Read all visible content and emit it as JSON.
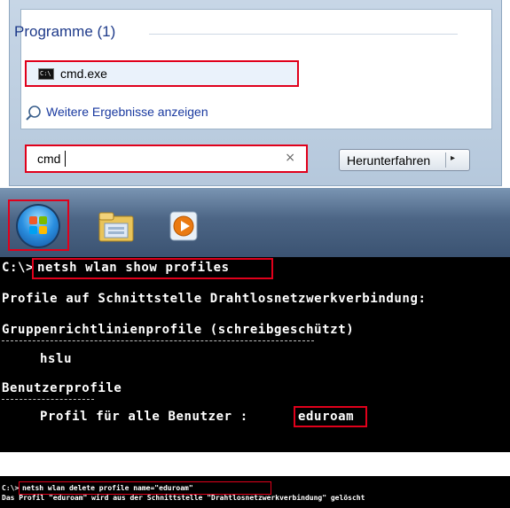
{
  "start_menu": {
    "section_header": "Programme (1)",
    "result_item": {
      "label": "cmd.exe",
      "icon": "cmd-icon"
    },
    "more_results_link": "Weitere Ergebnisse anzeigen",
    "search": {
      "value": "cmd"
    },
    "clear_symbol": "×",
    "shutdown_button": {
      "label": "Herunterfahren",
      "arrow": "▸"
    }
  },
  "taskbar": {
    "items": [
      "start-orb-icon",
      "windows-explorer-icon",
      "windows-media-player-icon"
    ]
  },
  "console_1": {
    "prompt": "C:\\>",
    "command": "netsh wlan show profiles",
    "line_interface": "Profile auf Schnittstelle Drahtlosnetzwerkverbindung:",
    "group_policy_header": "Gruppenrichtlinienprofile (schreibgeschützt)",
    "group_policy_profile": "hslu",
    "user_profiles_header": "Benutzerprofile",
    "user_profile_label": "Profil für alle Benutzer : ",
    "user_profile_value": "eduroam"
  },
  "console_2": {
    "prompt": "C:\\>",
    "command": "netsh wlan delete profile name=\"eduroam\"",
    "output": "Das Profil \"eduroam\" wird aus der Schnittstelle \"Drahtlosnetzwerkverbindung\" gelöscht"
  },
  "colors": {
    "highlight_border": "#e0001b",
    "link": "#1a3aa0",
    "header": "#1e3a8a",
    "console_bg": "#000000",
    "console_text": "#ffffff"
  }
}
